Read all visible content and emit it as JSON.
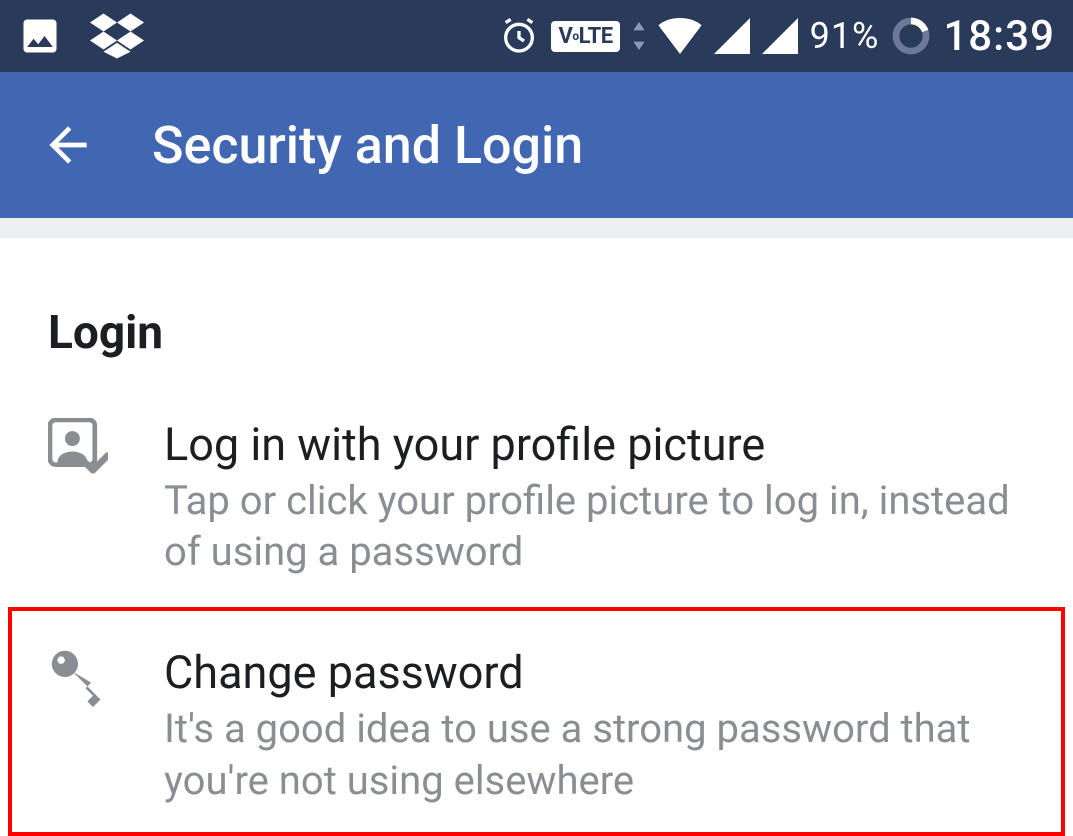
{
  "status_bar": {
    "battery_percent": "91%",
    "clock": "18:39",
    "volte_label": "VoLTE"
  },
  "app_bar": {
    "title": "Security and Login"
  },
  "section": {
    "header": "Login",
    "items": [
      {
        "title": "Log in with your profile picture",
        "subtitle": "Tap or click your profile picture to log in, instead of using a password"
      },
      {
        "title": "Change password",
        "subtitle": "It's a good idea to use a strong password that you're not using elsewhere"
      }
    ]
  }
}
